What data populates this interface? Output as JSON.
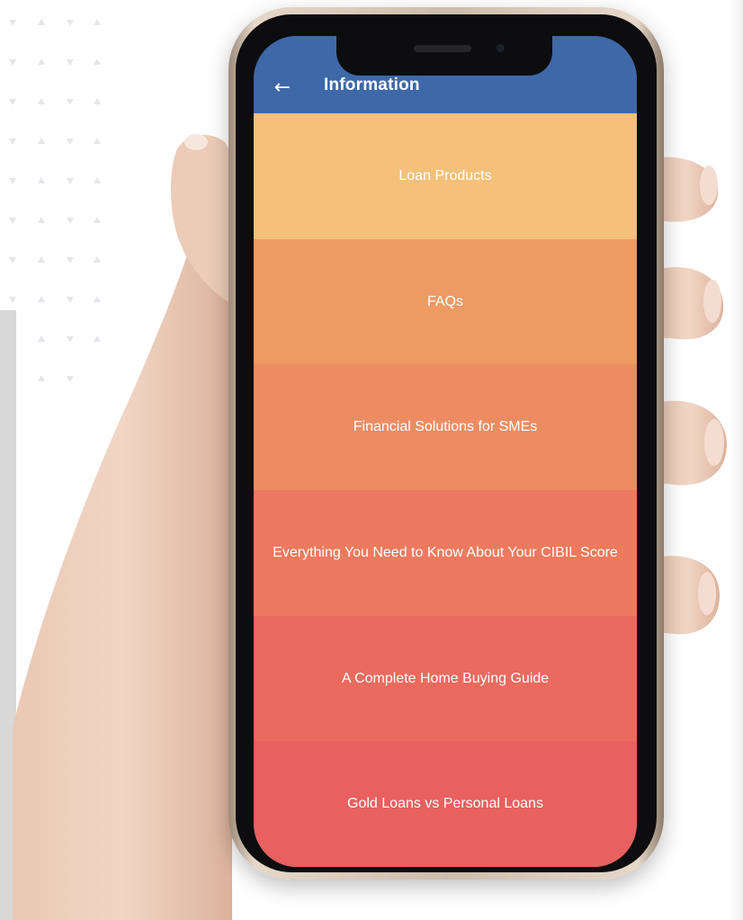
{
  "app_bar": {
    "title": "Information",
    "back_icon": "arrow-left-icon",
    "color": "#3e68a8"
  },
  "menu": {
    "items": [
      {
        "label": "Loan Products",
        "color": "#f4c07a"
      },
      {
        "label": "FAQs",
        "color": "#ee9a63"
      },
      {
        "label": "Financial Solutions for SMEs",
        "color": "#ed8c62"
      },
      {
        "label": "Everything You Need to Know About Your CIBIL Score",
        "color": "#ec7a5e"
      },
      {
        "label": "A Complete Home Buying Guide",
        "color": "#ea6a5e"
      },
      {
        "label": "Gold Loans vs Personal Loans",
        "color": "#e8605f"
      }
    ]
  }
}
